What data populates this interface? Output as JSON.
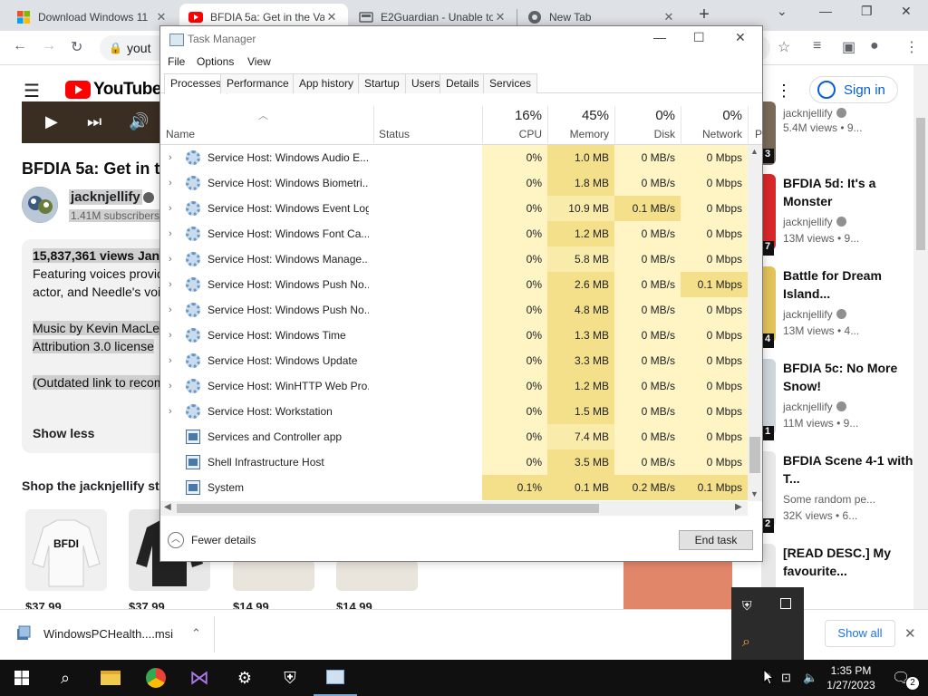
{
  "browser": {
    "tabs": [
      {
        "title": "Download Windows 11",
        "icon": "windows-icon"
      },
      {
        "title": "BFDIA 5a: Get in the Va",
        "icon": "youtube-icon"
      },
      {
        "title": "E2Guardian - Unable to",
        "icon": "e2guardian-icon"
      },
      {
        "title": "New Tab",
        "icon": "chrome-icon"
      }
    ],
    "omnibox_text": "yout"
  },
  "youtube": {
    "logo_text": "YouTube",
    "sign_in": "Sign in",
    "video_title": "BFDIA 5a: Get in th",
    "channel_name": "jacknjellify",
    "subscribers": "1.41M subscribers",
    "description": {
      "line1": "15,837,361 views  Jan",
      "line2": "Featuring voices provid",
      "line3": "actor, and Needle's voic",
      "line4": "Music by Kevin MacLeo",
      "line5": "Attribution 3.0 license",
      "line6": "(Outdated link to recom",
      "show_less": "Show less"
    },
    "shop_title": "Shop the jacknjellify stor",
    "merch_prices": [
      "$37.99",
      "$37.99",
      "$14.99",
      "$14.99"
    ],
    "recommendations": [
      {
        "title": "",
        "channel": "jacknjellify",
        "views": "5.4M views  •  9...",
        "duration": "3"
      },
      {
        "title": "BFDIA 5d: It's a Monster",
        "channel": "jacknjellify",
        "views": "13M views  •  9...",
        "duration": "7"
      },
      {
        "title": "Battle for Dream Island...",
        "channel": "jacknjellify",
        "views": "13M views  •  4...",
        "duration": "4"
      },
      {
        "title": "BFDIA 5c: No More Snow!",
        "channel": "jacknjellify",
        "views": "11M views  •  9...",
        "duration": "1"
      },
      {
        "title": "BFDIA Scene 4-1 with T...",
        "channel": "Some random pe...",
        "views": "32K views  •  6...",
        "duration": "2"
      },
      {
        "title": "[READ DESC.] My favourite...",
        "channel": "",
        "views": "",
        "duration": ""
      }
    ]
  },
  "download_bar": {
    "file": "WindowsPCHealth....msi",
    "show_all": "Show all"
  },
  "taskbar": {
    "time": "1:35 PM",
    "date": "1/27/2023",
    "notification_count": "2"
  },
  "task_manager": {
    "title": "Task Manager",
    "menu": [
      "File",
      "Options",
      "View"
    ],
    "tabs": [
      "Processes",
      "Performance",
      "App history",
      "Startup",
      "Users",
      "Details",
      "Services"
    ],
    "columns": {
      "name": "Name",
      "status": "Status",
      "cpu_pct": "16%",
      "cpu": "CPU",
      "memory_pct": "45%",
      "memory": "Memory",
      "disk_pct": "0%",
      "disk": "Disk",
      "network_pct": "0%",
      "network": "Network",
      "power": "P"
    },
    "processes": [
      {
        "name": "Service Host: Windows Audio E...",
        "cpu": "0%",
        "memory": "1.0 MB",
        "disk": "0 MB/s",
        "network": "0 Mbps",
        "expandable": true,
        "icon": "gear"
      },
      {
        "name": "Service Host: Windows Biometri...",
        "cpu": "0%",
        "memory": "1.8 MB",
        "disk": "0 MB/s",
        "network": "0 Mbps",
        "expandable": true,
        "icon": "gear"
      },
      {
        "name": "Service Host: Windows Event Log",
        "cpu": "0%",
        "memory": "10.9 MB",
        "disk": "0.1 MB/s",
        "network": "0 Mbps",
        "expandable": true,
        "icon": "gear"
      },
      {
        "name": "Service Host: Windows Font Ca...",
        "cpu": "0%",
        "memory": "1.2 MB",
        "disk": "0 MB/s",
        "network": "0 Mbps",
        "expandable": true,
        "icon": "gear"
      },
      {
        "name": "Service Host: Windows Manage...",
        "cpu": "0%",
        "memory": "5.8 MB",
        "disk": "0 MB/s",
        "network": "0 Mbps",
        "expandable": true,
        "icon": "gear"
      },
      {
        "name": "Service Host: Windows Push No...",
        "cpu": "0%",
        "memory": "2.6 MB",
        "disk": "0 MB/s",
        "network": "0.1 Mbps",
        "expandable": true,
        "icon": "gear"
      },
      {
        "name": "Service Host: Windows Push No...",
        "cpu": "0%",
        "memory": "4.8 MB",
        "disk": "0 MB/s",
        "network": "0 Mbps",
        "expandable": true,
        "icon": "gear"
      },
      {
        "name": "Service Host: Windows Time",
        "cpu": "0%",
        "memory": "1.3 MB",
        "disk": "0 MB/s",
        "network": "0 Mbps",
        "expandable": true,
        "icon": "gear"
      },
      {
        "name": "Service Host: Windows Update",
        "cpu": "0%",
        "memory": "3.3 MB",
        "disk": "0 MB/s",
        "network": "0 Mbps",
        "expandable": true,
        "icon": "gear"
      },
      {
        "name": "Service Host: WinHTTP Web Pro...",
        "cpu": "0%",
        "memory": "1.2 MB",
        "disk": "0 MB/s",
        "network": "0 Mbps",
        "expandable": true,
        "icon": "gear"
      },
      {
        "name": "Service Host: Workstation",
        "cpu": "0%",
        "memory": "1.5 MB",
        "disk": "0 MB/s",
        "network": "0 Mbps",
        "expandable": true,
        "icon": "gear"
      },
      {
        "name": "Services and Controller app",
        "cpu": "0%",
        "memory": "7.4 MB",
        "disk": "0 MB/s",
        "network": "0 Mbps",
        "expandable": false,
        "icon": "app"
      },
      {
        "name": "Shell Infrastructure Host",
        "cpu": "0%",
        "memory": "3.5 MB",
        "disk": "0 MB/s",
        "network": "0 Mbps",
        "expandable": false,
        "icon": "app"
      },
      {
        "name": "System",
        "cpu": "0.1%",
        "memory": "0.1 MB",
        "disk": "0.2 MB/s",
        "network": "0.1 Mbps",
        "expandable": false,
        "icon": "app"
      }
    ],
    "fewer_details": "Fewer details",
    "end_task": "End task",
    "colors": {
      "heat_light": "#fff4c4",
      "heat_mid": "#f9ecab",
      "heat_strong": "#f4e08a"
    }
  }
}
